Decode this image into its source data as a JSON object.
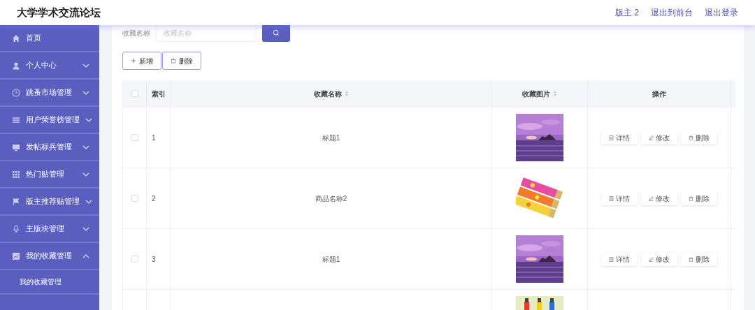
{
  "header": {
    "title": "大学学术交流论坛",
    "links": [
      "版主 2",
      "退出到前台",
      "退出登录"
    ]
  },
  "sidebar": {
    "items": [
      {
        "label": "首页"
      },
      {
        "label": "个人中心",
        "expanded": false
      },
      {
        "label": "跳蚤市场管理",
        "expanded": false
      },
      {
        "label": "用户荣誉榜管理",
        "expanded": false
      },
      {
        "label": "发帖标兵管理",
        "expanded": false
      },
      {
        "label": "热门贴管理",
        "expanded": false
      },
      {
        "label": "版主推荐贴管理",
        "expanded": false
      },
      {
        "label": "主版块管理",
        "expanded": false
      },
      {
        "label": "我的收藏管理",
        "expanded": true,
        "children": [
          {
            "label": "我的收藏管理"
          }
        ]
      }
    ]
  },
  "search": {
    "label": "收藏名称",
    "placeholder": "收藏名称"
  },
  "actions": [
    "新增",
    "删除"
  ],
  "table": {
    "columns": [
      "索引",
      "收藏名称",
      "收藏图片",
      "操作"
    ],
    "header_checked": false,
    "rows": [
      {
        "index": "1",
        "name": "标题1",
        "checked": false,
        "picture": {
          "kind": "picture"
        },
        "operations": [
          "详情",
          "修改",
          "删除"
        ]
      },
      {
        "index": "2",
        "name": "商品名称2",
        "checked": false,
        "picture": {
          "kind": "picture"
        },
        "operations": [
          "详情",
          "修改",
          "删除"
        ]
      },
      {
        "index": "3",
        "name": "标题1",
        "checked": false,
        "picture": {
          "kind": "picture"
        },
        "operations": [
          "详情",
          "修改",
          "删除"
        ]
      },
      {
        "picture": {
          "kind": "picture"
        }
      }
    ]
  }
}
